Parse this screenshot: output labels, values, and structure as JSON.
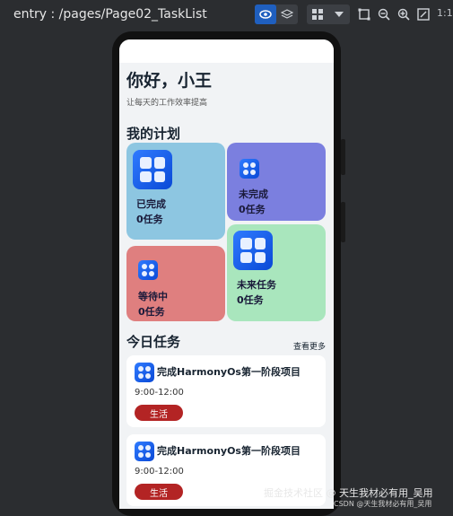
{
  "topbar": {
    "path": "entry : /pages/Page02_TaskList",
    "zoom_label": "1:1",
    "icons": [
      "eye-icon",
      "layers-icon",
      "grid-icon",
      "chevron-down-icon",
      "crop-icon",
      "zoom-out-icon",
      "zoom-in-icon",
      "fit-icon"
    ]
  },
  "app": {
    "greeting": "你好，小王",
    "subtitle": "让每天的工作效率提高",
    "plan_title": "我的计划",
    "plans": [
      {
        "label": "已完成",
        "count": "0任务",
        "color": "#8dc6e1"
      },
      {
        "label": "未完成",
        "count": "0任务",
        "color": "#7b7fdf"
      },
      {
        "label": "等待中",
        "count": "0任务",
        "color": "#df7f7f"
      },
      {
        "label": "未来任务",
        "count": "0任务",
        "color": "#a9e6bd"
      }
    ],
    "today_title": "今日任务",
    "more": "查看更多",
    "tasks": [
      {
        "title": "完成HarmonyOs第一阶段项目",
        "time": "9:00-12:00",
        "tag": "生活"
      },
      {
        "title": "完成HarmonyOs第一阶段项目",
        "time": "9:00-12:00",
        "tag": "生活"
      }
    ]
  },
  "watermark": {
    "line1": "掘金技术社区 @ 天生我材必有用_吴用",
    "line2": "CSDN @天生我材必有用_吴用"
  }
}
